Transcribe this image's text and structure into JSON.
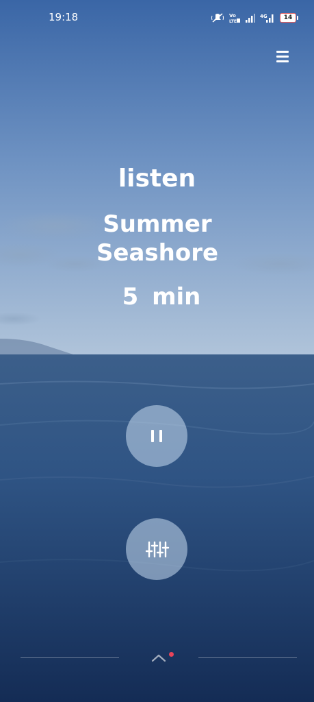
{
  "status_bar": {
    "time": "19:18",
    "battery_level": "14",
    "network_type": "4G",
    "volte_label": "Vo LTE",
    "icons": [
      "mute-icon",
      "volte-icon",
      "signal-icon",
      "4g-signal-icon",
      "battery-icon"
    ]
  },
  "header": {
    "menu_icon": "hamburger-menu-icon"
  },
  "player": {
    "mode": "listen",
    "title": "Summer Seashore",
    "duration": "5 min",
    "pause_icon": "pause-icon",
    "mixer_icon": "equalizer-sliders-icon"
  },
  "bottom_bar": {
    "expand_icon": "chevron-up-icon",
    "dot_color": "#e8445a"
  },
  "colors": {
    "sky_top": "#3f6ba8",
    "sky_horizon": "#a9bfd6",
    "sea_top": "#3a5f8c",
    "sea_bottom": "#15305a",
    "text": "#ffffff"
  }
}
